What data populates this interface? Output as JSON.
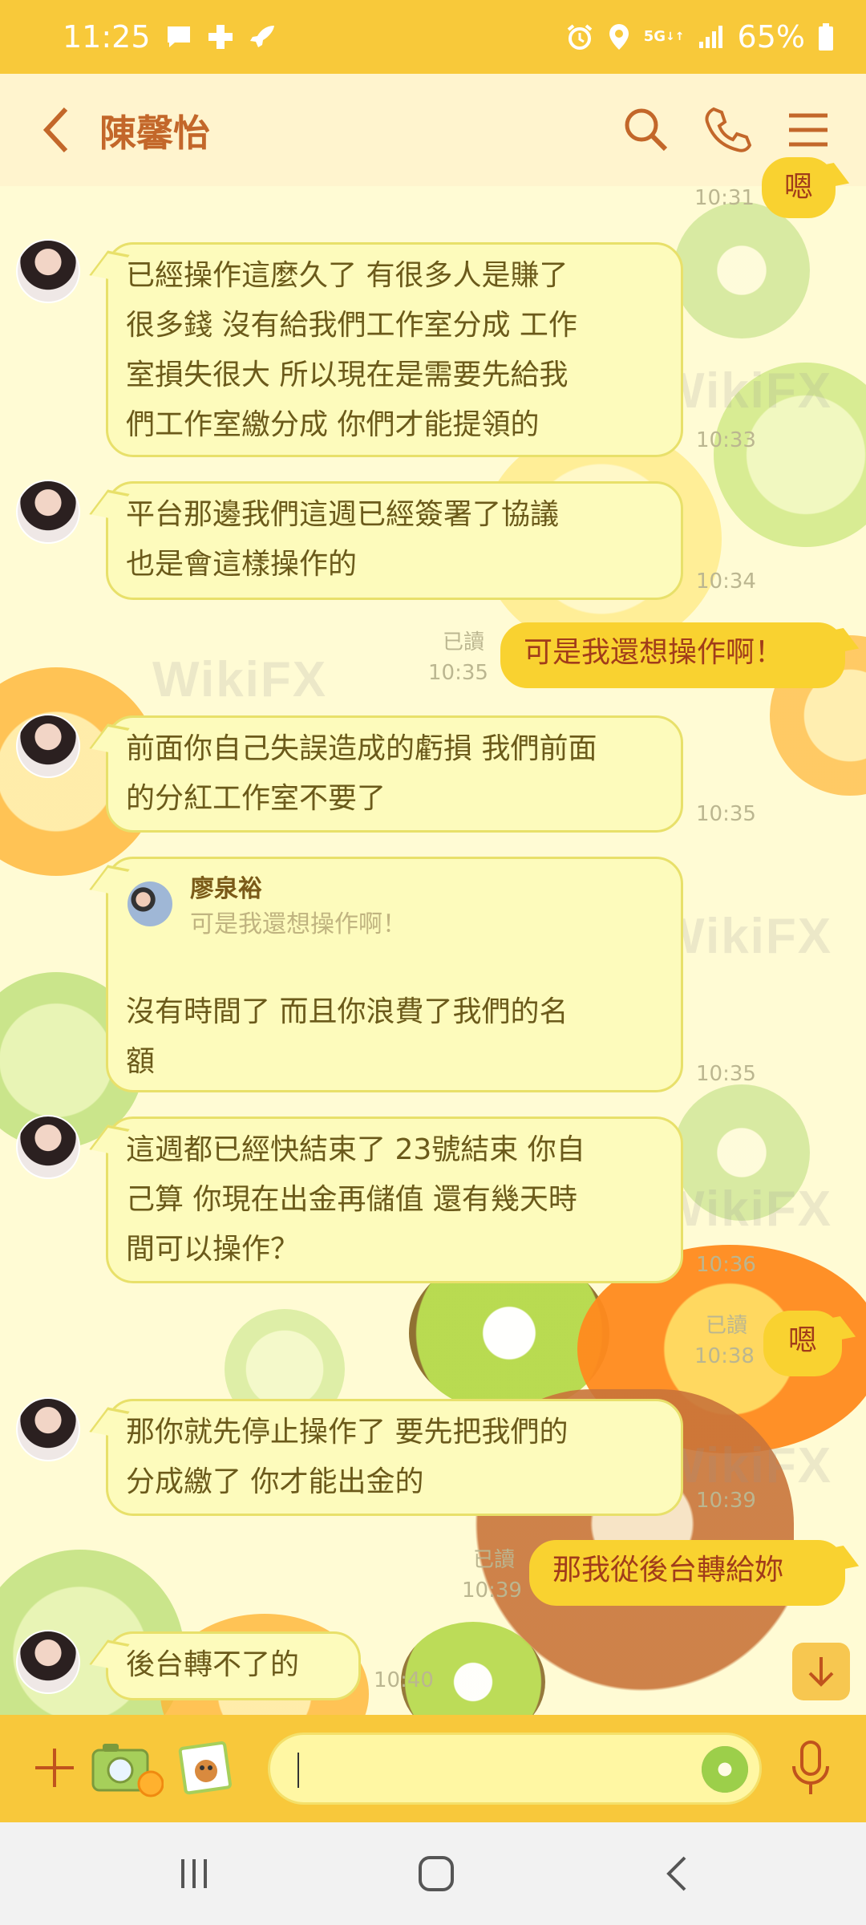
{
  "status_bar": {
    "time": "11:25",
    "network": "5G",
    "battery": "65%"
  },
  "header": {
    "title": "陳馨怡"
  },
  "watermark": "WikiFX",
  "messages": {
    "m0_time": "10:31",
    "m0_text": "嗯",
    "m1_lines": [
      "已經操作這麼久了  有很多人是賺了",
      "很多錢  沒有給我們工作室分成  工作",
      "室損失很大  所以現在是需要先給我",
      "們工作室繳分成  你們才能提領的"
    ],
    "m1_time": "10:33",
    "m2_lines": [
      "平台那邊我們這週已經簽署了協議",
      "也是會這樣操作的"
    ],
    "m2_time": "10:34",
    "m3_read": "已讀",
    "m3_time": "10:35",
    "m3_text": "可是我還想操作啊！",
    "m4_lines": [
      "前面你自己失誤造成的虧損 我們前面",
      "的分紅工作室不要了"
    ],
    "m4_time": "10:35",
    "m5_quote_name": "廖泉裕",
    "m5_quote_text": "可是我還想操作啊！",
    "m5_lines": [
      "沒有時間了  而且你浪費了我們的名",
      "額"
    ],
    "m5_time": "10:35",
    "m6_lines": [
      "這週都已經快結束了  23號結束  你自",
      "己算  你現在出金再儲值  還有幾天時",
      "間可以操作？"
    ],
    "m6_time": "10:36",
    "m7_read": "已讀",
    "m7_time": "10:38",
    "m7_text": "嗯",
    "m8_lines": [
      "那你就先停止操作了   要先把我們的",
      "分成繳了 你才能出金的"
    ],
    "m8_time": "10:39",
    "m9_read": "已讀",
    "m9_time": "10:39",
    "m9_text": "那我從後台轉給妳",
    "m10_text": "後台轉不了的",
    "m10_time": "10:40"
  },
  "input": {
    "placeholder": ""
  },
  "colors": {
    "status_bar": "#f8c93a",
    "header_title": "#c3672a",
    "incoming_bubble": "#fdfbbc",
    "outgoing_bubble": "#f9d230",
    "outgoing_text": "#a13c1a"
  }
}
